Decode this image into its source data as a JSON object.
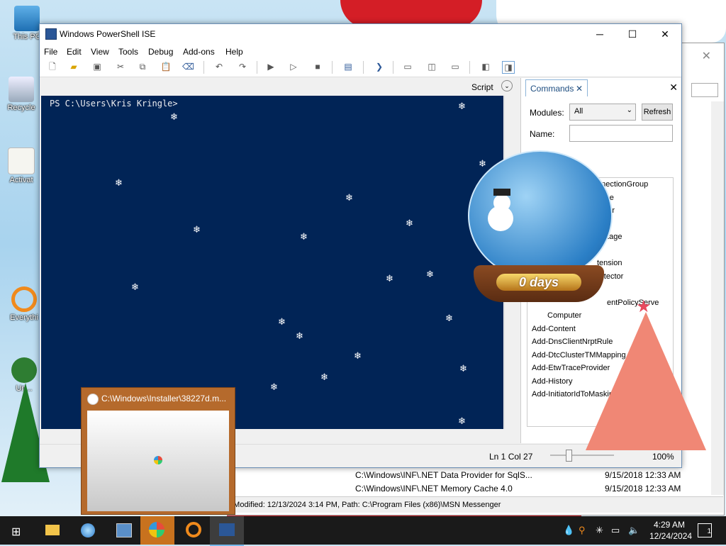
{
  "desktop": {
    "icons": [
      {
        "label": "This PC"
      },
      {
        "label": "Recycle"
      },
      {
        "label": "Activat"
      },
      {
        "label": "Everythi"
      },
      {
        "label": "Un..."
      }
    ]
  },
  "ise": {
    "title": "Windows PowerShell ISE",
    "menu": [
      "File",
      "Edit",
      "View",
      "Tools",
      "Debug",
      "Add-ons",
      "Help"
    ],
    "script_label": "Script",
    "console_prompt": "PS C:\\Users\\Kris Kringle>",
    "status": {
      "position": "Ln 1  Col 27",
      "zoom": "100%"
    }
  },
  "commands": {
    "tab_label": "Commands",
    "modules_label": "Modules:",
    "modules_value": "All",
    "refresh_label": "Refresh",
    "name_label": "Name:",
    "items": [
      "ConnectionGroup",
      "kage",
      "erver",
      "",
      "ackage",
      "",
      "tension",
      "rotector",
      "",
      "entPolicyServe",
      "Computer",
      "Add-Content",
      "Add-DnsClientNrptRule",
      "Add-DtcClusterTMMapping",
      "Add-EtwTraceProvider",
      "Add-History",
      "Add-InitiatorIdToMasking"
    ]
  },
  "background_window": {
    "rows": [
      {
        "name": "C:\\Windows\\INF\\.NET Data Provider for SqlS...",
        "date": "9/15/2018 12:33 AM"
      },
      {
        "name": "C:\\Windows\\INF\\.NET Memory Cache 4.0",
        "date": "9/15/2018 12:33 AM"
      }
    ],
    "status": "e Modified: 12/13/2024 3:14 PM, Path: C:\\Program Files (x86)\\MSN Messenger"
  },
  "popup": {
    "title": "C:\\Windows\\Installer\\38227d.m..."
  },
  "globe": {
    "days_text": "0 days"
  },
  "taskbar": {
    "time": "4:29 AM",
    "date": "12/24/2024",
    "notification_count": "1"
  }
}
